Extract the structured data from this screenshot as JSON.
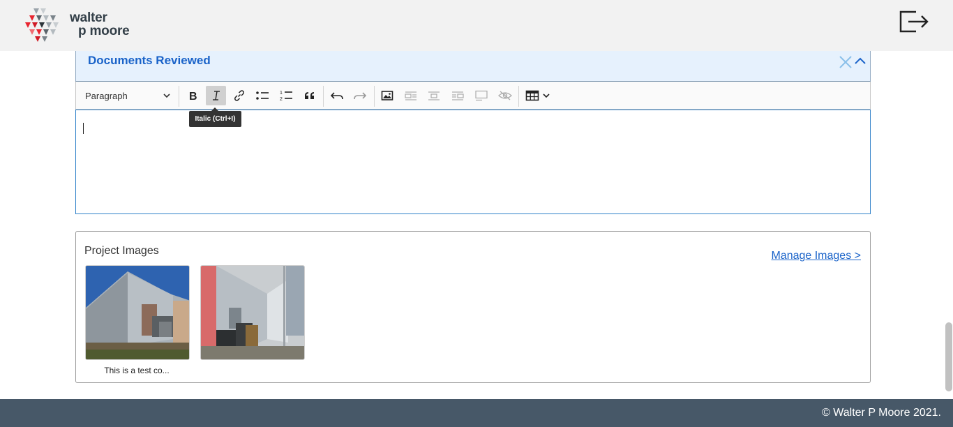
{
  "brand": {
    "line1": "walter",
    "line2": "p moore"
  },
  "header": {
    "logout_icon": "logout-icon"
  },
  "section": {
    "title": "Documents Reviewed"
  },
  "toolbar": {
    "heading_select": "Paragraph",
    "tooltip": "Italic (Ctrl+I)"
  },
  "editor": {
    "content": ""
  },
  "images": {
    "title": "Project Images",
    "manage_link": "Manage Images >",
    "items": [
      {
        "caption": "This is a test co..."
      },
      {
        "caption": ""
      }
    ]
  },
  "footer": {
    "copyright": "© Walter P Moore 2021."
  }
}
